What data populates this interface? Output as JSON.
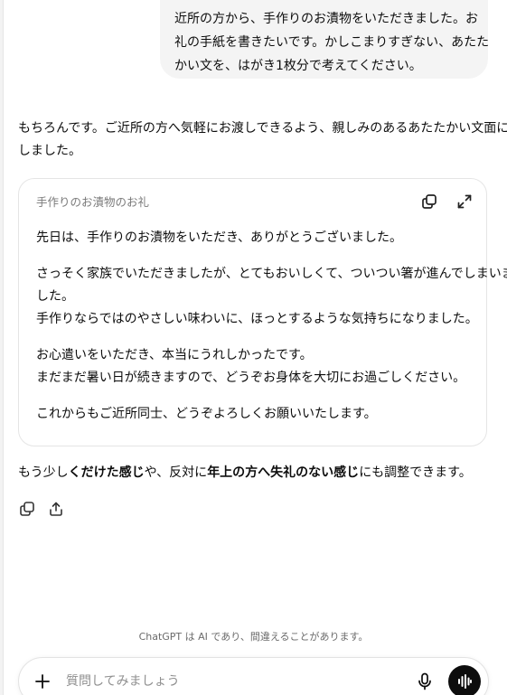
{
  "user_message": {
    "lines": [
      "近所の方から、手作りのお漬物をいただきました。お",
      "礼の手紙を書きたいです。かしこまりすぎない、あたた",
      "かい文を、はがき1枚分で考えてください。"
    ]
  },
  "assistant": {
    "intro_lines": [
      "もちろんです。ご近所の方へ気軽にお渡しできるよう、親しみのあるあたたかい文面に",
      "しました。"
    ],
    "card": {
      "title": "手作りのお漬物のお礼",
      "copy_icon": "copy-icon",
      "expand_icon": "expand-icon",
      "paragraphs": [
        [
          "先日は、手作りのお漬物をいただき、ありがとうございました。"
        ],
        [
          "さっそく家族でいただきましたが、とてもおいしくて、ついつい箸が進んでしまいま",
          "した。",
          "手作りならではのやさしい味わいに、ほっとするような気持ちになりました。"
        ],
        [
          "お心遣いをいただき、本当にうれしかったです。",
          "まだまだ暑い日が続きますので、どうぞお身体を大切にお過ごしください。"
        ],
        [
          "これからもご近所同士、どうぞよろしくお願いいたします。"
        ]
      ]
    },
    "followup": {
      "part1": "もう少し",
      "bold1": "くだけた感じ",
      "part2": "や、反対に",
      "bold2": "年上の方へ失礼のない感じ",
      "part3": "にも調整できます。"
    },
    "actions": [
      "copy-icon",
      "share-icon"
    ]
  },
  "disclaimer": "ChatGPT は AI であり、間違えることがあります。",
  "composer": {
    "placeholder": "質問してみましょう",
    "value": ""
  },
  "colors": {
    "bubble": "#f4f4f4",
    "text": "#0d0d0d",
    "muted": "#7a7a7a",
    "voice_button": "#0d0d0d"
  }
}
